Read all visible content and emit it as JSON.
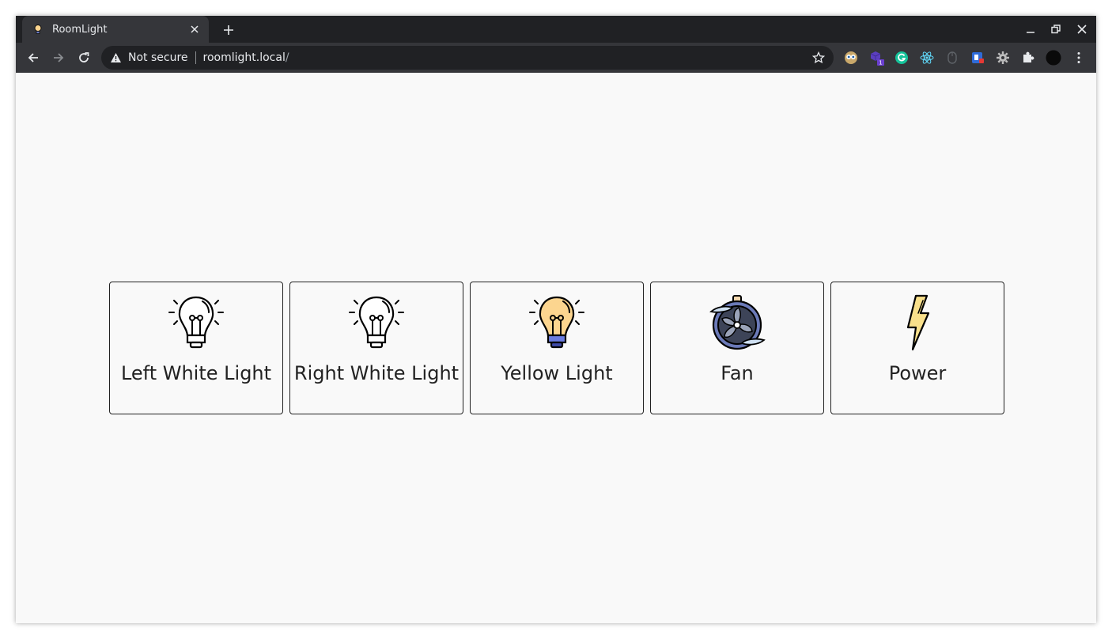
{
  "browser": {
    "tab": {
      "title": "RoomLight",
      "favicon": "bulb-icon"
    },
    "address": {
      "security_status": "Not secure",
      "host": "roomlight.local",
      "path": "/"
    },
    "extensions": [
      "owl-icon",
      "cube-icon",
      "grammarly-icon",
      "react-icon",
      "mouse-icon",
      "shield-icon",
      "gear-icon",
      "puzzle-icon",
      "profile-avatar"
    ],
    "extension_badge": "1"
  },
  "controls": [
    {
      "label": "Left White Light",
      "icon": "white-bulb-icon",
      "color": "#ffffff"
    },
    {
      "label": "Right White Light",
      "icon": "white-bulb-icon",
      "color": "#ffffff"
    },
    {
      "label": "Yellow Light",
      "icon": "yellow-bulb-icon",
      "color": "#fcd58f"
    },
    {
      "label": "Fan",
      "icon": "fan-icon",
      "color": "#5c6aa8"
    },
    {
      "label": "Power",
      "icon": "lightning-icon",
      "color": "#f9e08b"
    }
  ]
}
